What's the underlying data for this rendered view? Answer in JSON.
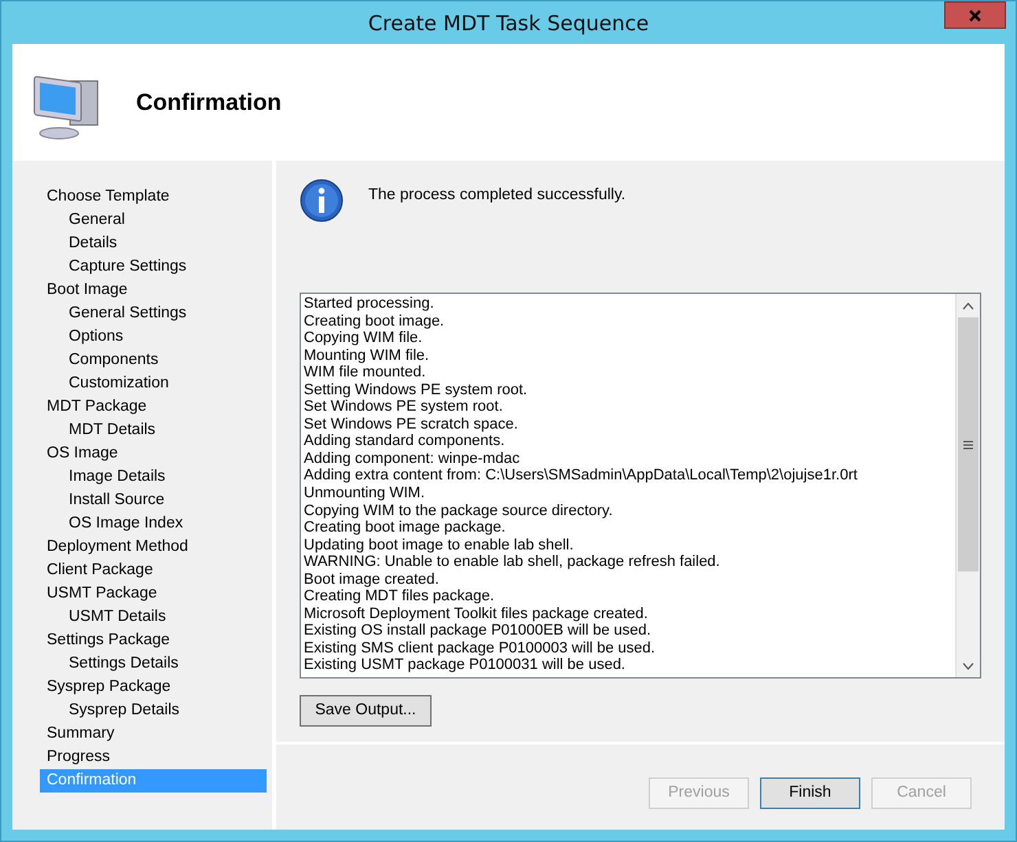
{
  "window": {
    "title": "Create MDT Task Sequence"
  },
  "header": {
    "title": "Confirmation"
  },
  "nav": [
    {
      "label": "Choose Template",
      "selected": false,
      "children": [
        {
          "label": "General",
          "selected": false
        },
        {
          "label": "Details",
          "selected": false
        },
        {
          "label": "Capture Settings",
          "selected": false
        }
      ]
    },
    {
      "label": "Boot Image",
      "selected": false,
      "children": [
        {
          "label": "General Settings",
          "selected": false
        },
        {
          "label": "Options",
          "selected": false
        },
        {
          "label": "Components",
          "selected": false
        },
        {
          "label": "Customization",
          "selected": false
        }
      ]
    },
    {
      "label": "MDT Package",
      "selected": false,
      "children": [
        {
          "label": "MDT Details",
          "selected": false
        }
      ]
    },
    {
      "label": "OS Image",
      "selected": false,
      "children": [
        {
          "label": "Image Details",
          "selected": false
        },
        {
          "label": "Install Source",
          "selected": false
        },
        {
          "label": "OS Image Index",
          "selected": false
        }
      ]
    },
    {
      "label": "Deployment Method",
      "selected": false
    },
    {
      "label": "Client Package",
      "selected": false
    },
    {
      "label": "USMT Package",
      "selected": false,
      "children": [
        {
          "label": "USMT Details",
          "selected": false
        }
      ]
    },
    {
      "label": "Settings Package",
      "selected": false,
      "children": [
        {
          "label": "Settings Details",
          "selected": false
        }
      ]
    },
    {
      "label": "Sysprep Package",
      "selected": false,
      "children": [
        {
          "label": "Sysprep Details",
          "selected": false
        }
      ]
    },
    {
      "label": "Summary",
      "selected": false
    },
    {
      "label": "Progress",
      "selected": false
    },
    {
      "label": "Confirmation",
      "selected": true
    }
  ],
  "message": "The process completed successfully.",
  "log": [
    "Started processing.",
    "Creating boot image.",
    "Copying WIM file.",
    "Mounting WIM file.",
    "WIM file mounted.",
    "Setting Windows PE system root.",
    "Set Windows PE system root.",
    "Set Windows PE scratch space.",
    "Adding standard components.",
    "Adding component: winpe-mdac",
    "Adding extra content from: C:\\Users\\SMSadmin\\AppData\\Local\\Temp\\2\\ojujse1r.0rt",
    "Unmounting WIM.",
    "Copying WIM to the package source directory.",
    "Creating boot image package.",
    "Updating boot image to enable lab shell.",
    "WARNING: Unable to enable lab shell, package refresh failed.",
    "Boot image created.",
    "Creating MDT files package.",
    "Microsoft Deployment Toolkit files package created.",
    "Existing OS install package P01000EB will be used.",
    "Existing SMS client package P0100003 will be used.",
    "Existing USMT package P0100031 will be used."
  ],
  "save_button": "Save Output...",
  "buttons": [
    {
      "label": "Previous",
      "disabled": true,
      "default": false
    },
    {
      "label": "Finish",
      "disabled": false,
      "default": true
    },
    {
      "label": "Cancel",
      "disabled": true,
      "default": false
    }
  ]
}
